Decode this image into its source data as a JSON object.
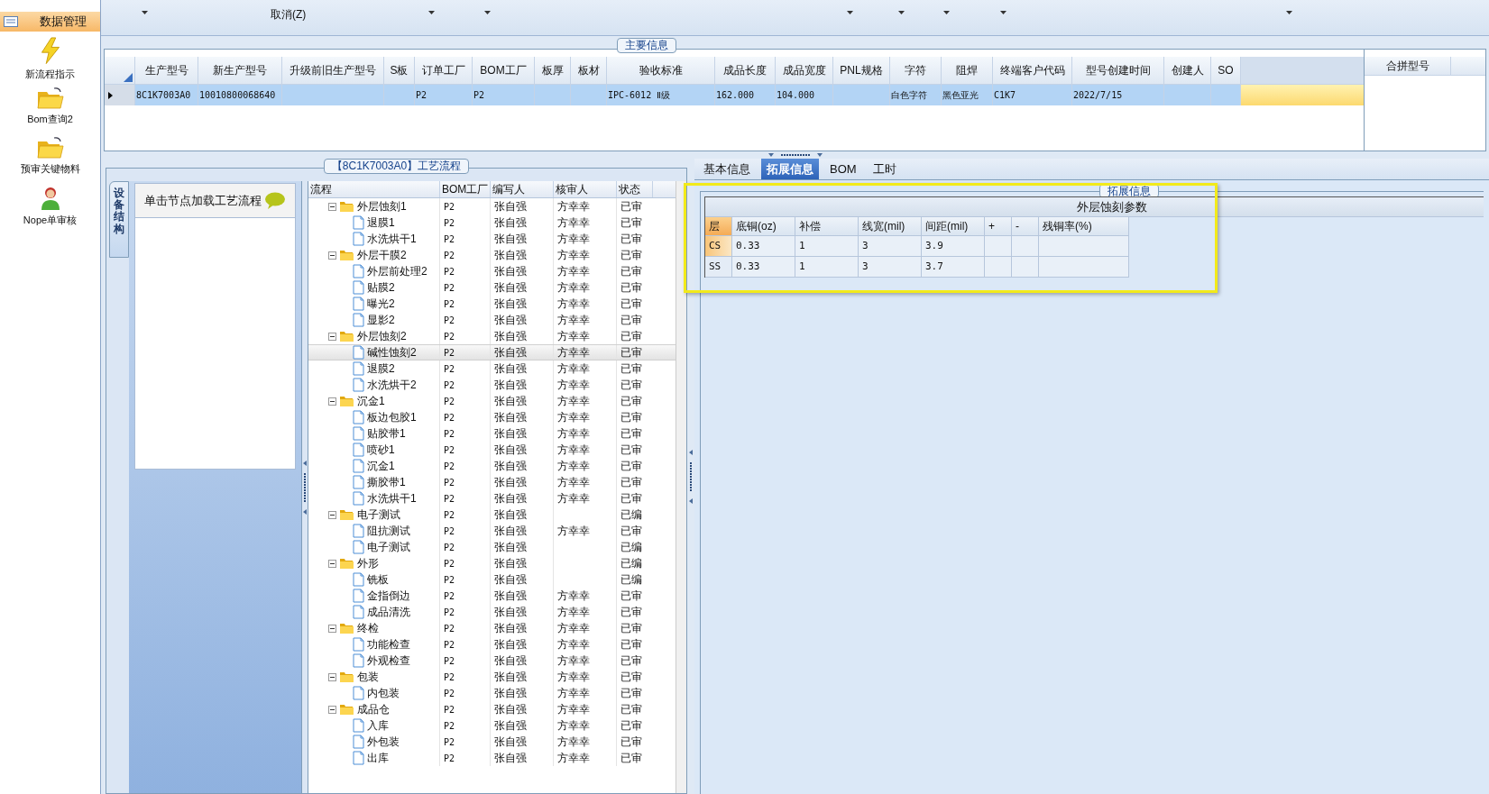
{
  "sidebar": {
    "header": {
      "label": "数据管理",
      "selected": true
    },
    "items": [
      {
        "label": "新流程指示",
        "kind": "lightning"
      },
      {
        "label": "Bom查询2",
        "kind": "folder"
      },
      {
        "label": "预审关键物料",
        "kind": "folder"
      },
      {
        "label": "Nope单审核",
        "kind": "user"
      }
    ]
  },
  "toolbar": {
    "cancel_label": "取消(Z)"
  },
  "main_info": {
    "title": "主要信息",
    "columns": [
      "生产型号",
      "新生产型号",
      "升级前旧生产型号",
      "S板",
      "订单工厂",
      "BOM工厂",
      "板厚",
      "板材",
      "验收标准",
      "成品长度",
      "成品宽度",
      "PNL规格",
      "字符",
      "阻焊",
      "终端客户代码",
      "型号创建时间",
      "创建人",
      "SO"
    ],
    "rows": [
      {
        "selected": true,
        "cells": [
          "8C1K7003A0",
          "10010800068640",
          null,
          null,
          "P2",
          "P2",
          null,
          null,
          "IPC-6012 Ⅱ级",
          "162.000",
          "104.000",
          null,
          "白色字符",
          "黑色亚光",
          "C1K7",
          "2022/7/15",
          null,
          null
        ]
      }
    ],
    "side_columns": [
      "合拼型号"
    ]
  },
  "process": {
    "title": "【8C1K7003A0】工艺流程",
    "side_tab": "设备结构",
    "hint": "单击节点加载工艺流程",
    "columns": [
      "流程",
      "BOM工厂",
      "编写人",
      "核审人",
      "状态"
    ],
    "tree": [
      {
        "name": "外层蚀刻1",
        "bom": "P2",
        "writer": "张自强",
        "reviewer": "方幸幸",
        "status": "已审",
        "expanded": true,
        "selected": false,
        "children": [
          {
            "name": "退膜1",
            "bom": "P2",
            "writer": "张自强",
            "reviewer": "方幸幸",
            "status": "已审",
            "selected": false
          },
          {
            "name": "水洗烘干1",
            "bom": "P2",
            "writer": "张自强",
            "reviewer": "方幸幸",
            "status": "已审",
            "selected": false
          }
        ]
      },
      {
        "name": "外层干膜2",
        "bom": "P2",
        "writer": "张自强",
        "reviewer": "方幸幸",
        "status": "已审",
        "expanded": true,
        "selected": false,
        "children": [
          {
            "name": "外层前处理2",
            "bom": "P2",
            "writer": "张自强",
            "reviewer": "方幸幸",
            "status": "已审",
            "selected": false
          },
          {
            "name": "贴膜2",
            "bom": "P2",
            "writer": "张自强",
            "reviewer": "方幸幸",
            "status": "已审",
            "selected": false
          },
          {
            "name": "曝光2",
            "bom": "P2",
            "writer": "张自强",
            "reviewer": "方幸幸",
            "status": "已审",
            "selected": false
          },
          {
            "name": "显影2",
            "bom": "P2",
            "writer": "张自强",
            "reviewer": "方幸幸",
            "status": "已审",
            "selected": false
          }
        ]
      },
      {
        "name": "外层蚀刻2",
        "bom": "P2",
        "writer": "张自强",
        "reviewer": "方幸幸",
        "status": "已审",
        "expanded": true,
        "selected": false,
        "children": [
          {
            "name": "碱性蚀刻2",
            "bom": "P2",
            "writer": "张自强",
            "reviewer": "方幸幸",
            "status": "已审",
            "selected": true
          },
          {
            "name": "退膜2",
            "bom": "P2",
            "writer": "张自强",
            "reviewer": "方幸幸",
            "status": "已审",
            "selected": false
          },
          {
            "name": "水洗烘干2",
            "bom": "P2",
            "writer": "张自强",
            "reviewer": "方幸幸",
            "status": "已审",
            "selected": false
          }
        ]
      },
      {
        "name": "沉金1",
        "bom": "P2",
        "writer": "张自强",
        "reviewer": "方幸幸",
        "status": "已审",
        "expanded": true,
        "selected": false,
        "children": [
          {
            "name": "板边包胶1",
            "bom": "P2",
            "writer": "张自强",
            "reviewer": "方幸幸",
            "status": "已审",
            "selected": false
          },
          {
            "name": "贴胶带1",
            "bom": "P2",
            "writer": "张自强",
            "reviewer": "方幸幸",
            "status": "已审",
            "selected": false
          },
          {
            "name": "喷砂1",
            "bom": "P2",
            "writer": "张自强",
            "reviewer": "方幸幸",
            "status": "已审",
            "selected": false
          },
          {
            "name": "沉金1",
            "bom": "P2",
            "writer": "张自强",
            "reviewer": "方幸幸",
            "status": "已审",
            "selected": false
          },
          {
            "name": "撕胶带1",
            "bom": "P2",
            "writer": "张自强",
            "reviewer": "方幸幸",
            "status": "已审",
            "selected": false
          },
          {
            "name": "水洗烘干1",
            "bom": "P2",
            "writer": "张自强",
            "reviewer": "方幸幸",
            "status": "已审",
            "selected": false
          }
        ]
      },
      {
        "name": "电子测试",
        "bom": "P2",
        "writer": "张自强",
        "status": "已编",
        "expanded": true,
        "selected": false,
        "children": [
          {
            "name": "阻抗测试",
            "bom": "P2",
            "writer": "张自强",
            "reviewer": "方幸幸",
            "status": "已审",
            "selected": false
          },
          {
            "name": "电子测试",
            "bom": "P2",
            "writer": "张自强",
            "status": "已编",
            "selected": false
          }
        ]
      },
      {
        "name": "外形",
        "bom": "P2",
        "writer": "张自强",
        "status": "已编",
        "expanded": true,
        "selected": false,
        "children": [
          {
            "name": "铣板",
            "bom": "P2",
            "writer": "张自强",
            "status": "已编",
            "selected": false
          },
          {
            "name": "金指倒边",
            "bom": "P2",
            "writer": "张自强",
            "reviewer": "方幸幸",
            "status": "已审",
            "selected": false
          },
          {
            "name": "成品清洗",
            "bom": "P2",
            "writer": "张自强",
            "reviewer": "方幸幸",
            "status": "已审",
            "selected": false
          }
        ]
      },
      {
        "name": "终检",
        "bom": "P2",
        "writer": "张自强",
        "reviewer": "方幸幸",
        "status": "已审",
        "expanded": true,
        "selected": false,
        "children": [
          {
            "name": "功能检查",
            "bom": "P2",
            "writer": "张自强",
            "reviewer": "方幸幸",
            "status": "已审",
            "selected": false
          },
          {
            "name": "外观检查",
            "bom": "P2",
            "writer": "张自强",
            "reviewer": "方幸幸",
            "status": "已审",
            "selected": false
          }
        ]
      },
      {
        "name": "包装",
        "bom": "P2",
        "writer": "张自强",
        "reviewer": "方幸幸",
        "status": "已审",
        "expanded": true,
        "selected": false,
        "children": [
          {
            "name": "内包装",
            "bom": "P2",
            "writer": "张自强",
            "reviewer": "方幸幸",
            "status": "已审",
            "selected": false
          }
        ]
      },
      {
        "name": "成品仓",
        "bom": "P2",
        "writer": "张自强",
        "reviewer": "方幸幸",
        "status": "已审",
        "expanded": true,
        "selected": false,
        "children": [
          {
            "name": "入库",
            "bom": "P2",
            "writer": "张自强",
            "reviewer": "方幸幸",
            "status": "已审",
            "selected": false
          },
          {
            "name": "外包装",
            "bom": "P2",
            "writer": "张自强",
            "reviewer": "方幸幸",
            "status": "已审",
            "selected": false
          },
          {
            "name": "出库",
            "bom": "P2",
            "writer": "张自强",
            "reviewer": "方幸幸",
            "status": "已审",
            "selected": false
          }
        ]
      }
    ]
  },
  "detail_tabs": [
    {
      "label": "基本信息",
      "selected": false
    },
    {
      "label": "拓展信息",
      "selected": true
    },
    {
      "label": "BOM",
      "selected": false
    },
    {
      "label": "工时",
      "selected": false
    }
  ],
  "extension": {
    "group_title": "拓展信息",
    "table_title": "外层蚀刻参数",
    "columns": [
      {
        "label": "层",
        "selected": true
      },
      {
        "label": "底铜(oz)",
        "selected": false
      },
      {
        "label": "补偿",
        "selected": false
      },
      {
        "label": "线宽(mil)",
        "selected": false
      },
      {
        "label": "间距(mil)",
        "selected": false
      },
      {
        "label": "+",
        "selected": false
      },
      {
        "label": "-",
        "selected": false
      },
      {
        "label": "残铜率(%)",
        "selected": false
      }
    ],
    "rows": [
      {
        "selected": true,
        "cells": [
          "CS",
          "0.33",
          "1",
          "3",
          "3.9",
          null,
          null,
          null
        ]
      },
      {
        "selected": false,
        "cells": [
          "SS",
          "0.33",
          "1",
          "3",
          "3.7",
          null,
          null,
          null
        ]
      }
    ]
  }
}
